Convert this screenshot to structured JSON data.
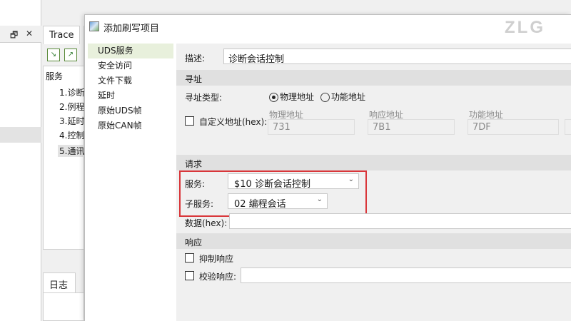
{
  "background": {
    "left_controls": [
      "🗗",
      "✕"
    ],
    "trace_tab": "Trace",
    "tree_header": "服务",
    "tree_items": [
      "1.诊断",
      "2.例程",
      "3.延时",
      "4.控制",
      "5.通讯"
    ],
    "log_tab": "日志"
  },
  "dialog": {
    "title": "添加刷写项目",
    "logo": "ZLG",
    "side_items": [
      "UDS服务",
      "安全访问",
      "文件下载",
      "延时",
      "原始UDS帧",
      "原始CAN帧"
    ],
    "desc_label": "描述:",
    "desc_value": "诊断会话控制",
    "addr_section": "寻址",
    "addr_type_label": "寻址类型:",
    "addr_options": [
      "物理地址",
      "功能地址"
    ],
    "custom_addr_label": "自定义地址(hex):",
    "phys_label": "物理地址",
    "phys_value": "731",
    "resp_label": "响应地址",
    "resp_value": "7B1",
    "func_label": "功能地址",
    "func_value": "7DF",
    "req_section": "请求",
    "service_label": "服务:",
    "service_value": "$10 诊断会话控制",
    "subservice_label": "子服务:",
    "subservice_value": "02 编程会话",
    "data_label": "数据(hex):",
    "resp_section": "响应",
    "suppress_label": "抑制响应",
    "verify_label": "校验响应:"
  },
  "colors": {
    "highlight": "#d9363a",
    "selected_bg": "#e8f0dc"
  }
}
